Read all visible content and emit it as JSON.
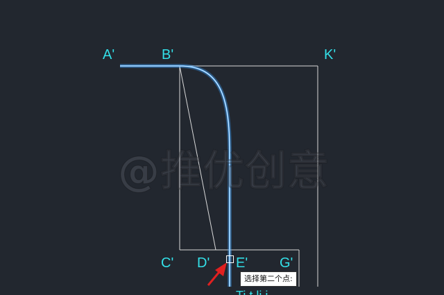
{
  "drawing": {
    "labels": {
      "A": "A'",
      "B": "B'",
      "K": "K'",
      "C": "C'",
      "D": "D'",
      "E": "E'",
      "G": "G'"
    },
    "truncated_text": "Ti      t  li      i     "
  },
  "watermark": "@推优创意",
  "tooltip": "选择第二个点:",
  "colors": {
    "background": "#22272f",
    "label": "#33e0e8",
    "line": "#d9d9d9",
    "highlight": "#3fa2ff",
    "arrow": "#e02020"
  },
  "icons": {
    "cursor": "pick-box-icon",
    "arrow": "red-arrow-icon"
  }
}
